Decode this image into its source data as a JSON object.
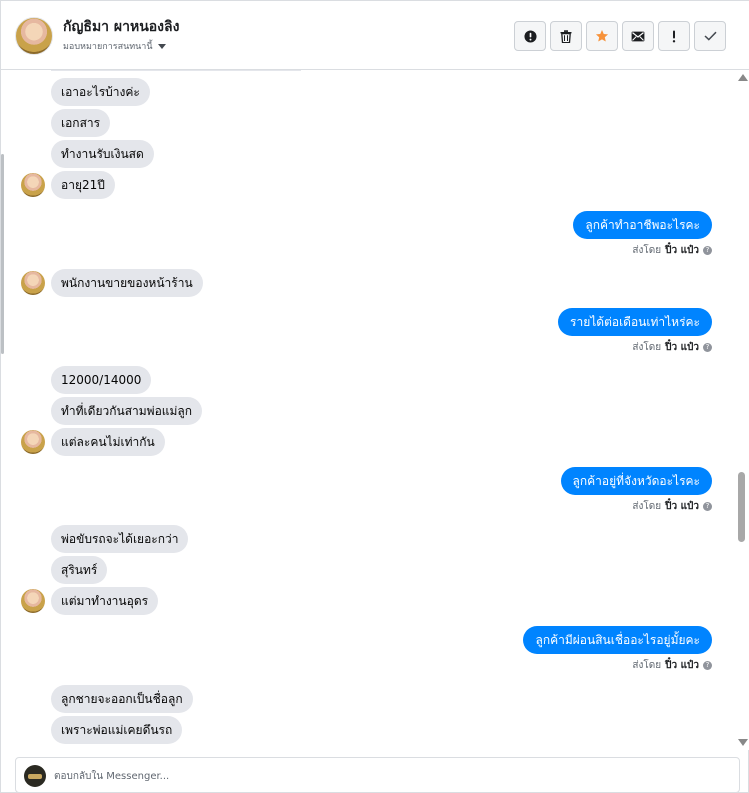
{
  "header": {
    "contact_name": "กัญธิมา ผาหนองลิง",
    "assign_label": "มอบหมายการสนทนานี้",
    "actions": [
      {
        "name": "report-spam-button",
        "icon": "alert-circle-icon"
      },
      {
        "name": "delete-button",
        "icon": "trash-icon"
      },
      {
        "name": "star-button",
        "icon": "star-icon"
      },
      {
        "name": "mark-unread-button",
        "icon": "envelope-icon"
      },
      {
        "name": "follow-up-button",
        "icon": "exclamation-icon"
      },
      {
        "name": "mark-done-button",
        "icon": "checkmark-icon"
      }
    ]
  },
  "colors": {
    "outgoing_bubble": "#0084ff",
    "incoming_bubble": "#e4e6eb",
    "star": "#f7923a"
  },
  "messages": [
    {
      "dir": "in",
      "text": "เอาอะไรบ้างค่ะ"
    },
    {
      "dir": "in",
      "text": "เอกสาร"
    },
    {
      "dir": "in",
      "text": "ทำงานรับเงินสด"
    },
    {
      "dir": "in",
      "text": "อายุ21ปี",
      "avatar": true
    },
    {
      "dir": "out",
      "text": "ลูกค้าทำอาชีพอะไรคะ"
    },
    {
      "dir": "in",
      "text": "พนักงานขายของหน้าร้าน",
      "avatar": true
    },
    {
      "dir": "out",
      "text": "รายได้ต่อเดือนเท่าไหร่คะ"
    },
    {
      "dir": "in",
      "text": "12000/14000"
    },
    {
      "dir": "in",
      "text": "ทำที่เดียวกันสามพ่อแม่ลูก"
    },
    {
      "dir": "in",
      "text": "แต่ละคนไม่เท่ากัน",
      "avatar": true
    },
    {
      "dir": "out",
      "text": "ลูกค้าอยู่ที่จังหวัดอะไรคะ"
    },
    {
      "dir": "in",
      "text": "พ่อขับรถจะได้เยอะกว่า"
    },
    {
      "dir": "in",
      "text": "สุรินทร์"
    },
    {
      "dir": "in",
      "text": "แต่มาทำงานอุดร",
      "avatar": true
    },
    {
      "dir": "out",
      "text": "ลูกค้ามีผ่อนสินเชื่ออะไรอยู่มั้ยคะ"
    },
    {
      "dir": "in",
      "text": "ลูกชายจะออกเป็นชื่อลูก"
    },
    {
      "dir": "in",
      "text": "เพราะพ่อแม่เคยดึนรถ"
    }
  ],
  "sent_by": {
    "prefix": "ส่งโดย",
    "sender": "ปิ๋ว แป๋ว",
    "help_icon": "question-circle-icon"
  },
  "composer": {
    "placeholder": "ตอบกลับใน Messenger..."
  }
}
